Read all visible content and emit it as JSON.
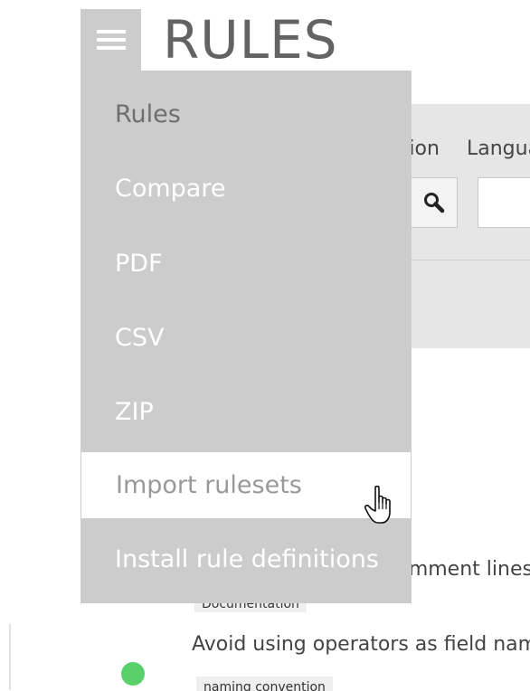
{
  "header": {
    "title": "RULES",
    "menu_icon": "hamburger-icon"
  },
  "menu": {
    "items": [
      {
        "label": "Rules",
        "state": "current"
      },
      {
        "label": "Compare",
        "state": "normal"
      },
      {
        "label": "PDF",
        "state": "normal"
      },
      {
        "label": "CSV",
        "state": "normal"
      },
      {
        "label": "ZIP",
        "state": "normal"
      },
      {
        "label": "Import rulesets",
        "state": "hovered"
      },
      {
        "label": "Install rule definitions",
        "state": "normal"
      }
    ]
  },
  "filters": {
    "action_label": "Action",
    "language_label": "Language",
    "search_icon": "search-icon",
    "language_value": ""
  },
  "rules": [
    {
      "title": "Comment lines",
      "tag": "Documentation"
    },
    {
      "title": "Avoid using operators as field names",
      "tag": "naming convention",
      "status": "active"
    }
  ],
  "colors": {
    "menu_background": "#cccccc",
    "menu_text": "#ffffff",
    "menu_current_text": "#6f6f6f",
    "menu_hover_background": "#ffffff",
    "menu_hover_text": "#999999",
    "title": "#636363",
    "status_active": "#5ad06a"
  },
  "cursor": "pointer-hand-icon"
}
